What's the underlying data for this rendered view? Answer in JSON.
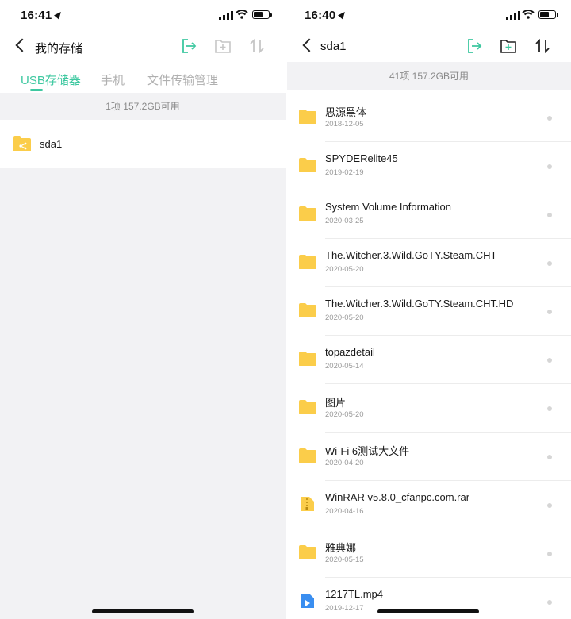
{
  "colors": {
    "accent": "#3ec8a0",
    "folder": "#fbcd4a",
    "summary_bg": "#f2f2f4"
  },
  "left": {
    "status": {
      "time": "16:41"
    },
    "nav": {
      "title": "我的存储"
    },
    "tabs": [
      {
        "label": "USB存储器",
        "active": true
      },
      {
        "label": "手机",
        "active": false
      },
      {
        "label": "文件传输管理",
        "active": false
      }
    ],
    "summary": "1项 157.2GB可用",
    "items": [
      {
        "name": "sda1",
        "icon": "usb-folder-icon"
      }
    ]
  },
  "right": {
    "status": {
      "time": "16:40"
    },
    "nav": {
      "title": "sda1"
    },
    "summary": "41项 157.2GB可用",
    "items": [
      {
        "name": "思源黑体",
        "date": "2018-12-05",
        "icon": "folder-icon"
      },
      {
        "name": "SPYDERelite45",
        "date": "2019-02-19",
        "icon": "folder-icon"
      },
      {
        "name": "System Volume Information",
        "date": "2020-03-25",
        "icon": "folder-icon"
      },
      {
        "name": "The.Witcher.3.Wild.GoTY.Steam.CHT",
        "date": "2020-05-20",
        "icon": "folder-icon"
      },
      {
        "name": "The.Witcher.3.Wild.GoTY.Steam.CHT.HD",
        "date": "2020-05-20",
        "icon": "folder-icon"
      },
      {
        "name": "topazdetail",
        "date": "2020-05-14",
        "icon": "folder-icon"
      },
      {
        "name": "图片",
        "date": "2020-05-20",
        "icon": "folder-icon"
      },
      {
        "name": "Wi-Fi 6测试大文件",
        "date": "2020-04-20",
        "icon": "folder-icon"
      },
      {
        "name": "WinRAR v5.8.0_cfanpc.com.rar",
        "date": "2020-04-16",
        "icon": "archive-file-icon"
      },
      {
        "name": "雅典娜",
        "date": "2020-05-15",
        "icon": "folder-icon"
      },
      {
        "name": "1217TL.mp4",
        "date": "2019-12-17",
        "icon": "video-file-icon"
      }
    ]
  }
}
